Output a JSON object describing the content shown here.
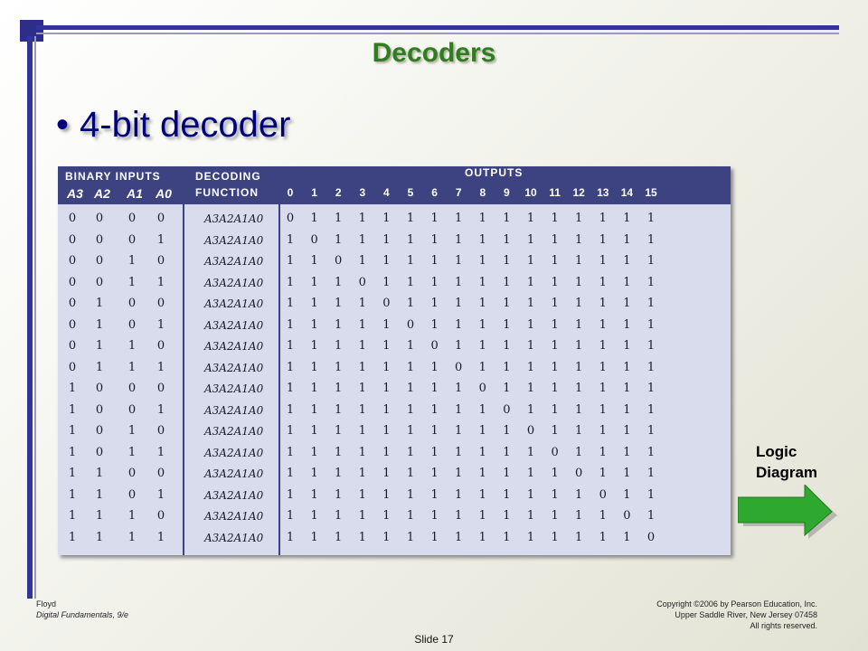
{
  "title": "Decoders",
  "bullet": "4-bit decoder",
  "table": {
    "group_headers": {
      "inputs": "BINARY INPUTS",
      "decoding": "DECODING",
      "function": "FUNCTION",
      "outputs": "OUTPUTS"
    },
    "input_headers": [
      "A3",
      "A2",
      "A1",
      "A0"
    ],
    "output_headers": [
      "0",
      "1",
      "2",
      "3",
      "4",
      "5",
      "6",
      "7",
      "8",
      "9",
      "10",
      "11",
      "12",
      "13",
      "14",
      "15"
    ],
    "rows": [
      {
        "inputs": [
          "0",
          "0",
          "0",
          "0"
        ],
        "fn": "A3A2A1A0",
        "outputs": [
          "0",
          "1",
          "1",
          "1",
          "1",
          "1",
          "1",
          "1",
          "1",
          "1",
          "1",
          "1",
          "1",
          "1",
          "1",
          "1"
        ]
      },
      {
        "inputs": [
          "0",
          "0",
          "0",
          "1"
        ],
        "fn": "A3A2A1A0",
        "outputs": [
          "1",
          "0",
          "1",
          "1",
          "1",
          "1",
          "1",
          "1",
          "1",
          "1",
          "1",
          "1",
          "1",
          "1",
          "1",
          "1"
        ]
      },
      {
        "inputs": [
          "0",
          "0",
          "1",
          "0"
        ],
        "fn": "A3A2A1A0",
        "outputs": [
          "1",
          "1",
          "0",
          "1",
          "1",
          "1",
          "1",
          "1",
          "1",
          "1",
          "1",
          "1",
          "1",
          "1",
          "1",
          "1"
        ]
      },
      {
        "inputs": [
          "0",
          "0",
          "1",
          "1"
        ],
        "fn": "A3A2A1A0",
        "outputs": [
          "1",
          "1",
          "1",
          "0",
          "1",
          "1",
          "1",
          "1",
          "1",
          "1",
          "1",
          "1",
          "1",
          "1",
          "1",
          "1"
        ]
      },
      {
        "inputs": [
          "0",
          "1",
          "0",
          "0"
        ],
        "fn": "A3A2A1A0",
        "outputs": [
          "1",
          "1",
          "1",
          "1",
          "0",
          "1",
          "1",
          "1",
          "1",
          "1",
          "1",
          "1",
          "1",
          "1",
          "1",
          "1"
        ]
      },
      {
        "inputs": [
          "0",
          "1",
          "0",
          "1"
        ],
        "fn": "A3A2A1A0",
        "outputs": [
          "1",
          "1",
          "1",
          "1",
          "1",
          "0",
          "1",
          "1",
          "1",
          "1",
          "1",
          "1",
          "1",
          "1",
          "1",
          "1"
        ]
      },
      {
        "inputs": [
          "0",
          "1",
          "1",
          "0"
        ],
        "fn": "A3A2A1A0",
        "outputs": [
          "1",
          "1",
          "1",
          "1",
          "1",
          "1",
          "0",
          "1",
          "1",
          "1",
          "1",
          "1",
          "1",
          "1",
          "1",
          "1"
        ]
      },
      {
        "inputs": [
          "0",
          "1",
          "1",
          "1"
        ],
        "fn": "A3A2A1A0",
        "outputs": [
          "1",
          "1",
          "1",
          "1",
          "1",
          "1",
          "1",
          "0",
          "1",
          "1",
          "1",
          "1",
          "1",
          "1",
          "1",
          "1"
        ]
      },
      {
        "inputs": [
          "1",
          "0",
          "0",
          "0"
        ],
        "fn": "A3A2A1A0",
        "outputs": [
          "1",
          "1",
          "1",
          "1",
          "1",
          "1",
          "1",
          "1",
          "0",
          "1",
          "1",
          "1",
          "1",
          "1",
          "1",
          "1"
        ]
      },
      {
        "inputs": [
          "1",
          "0",
          "0",
          "1"
        ],
        "fn": "A3A2A1A0",
        "outputs": [
          "1",
          "1",
          "1",
          "1",
          "1",
          "1",
          "1",
          "1",
          "1",
          "0",
          "1",
          "1",
          "1",
          "1",
          "1",
          "1"
        ]
      },
      {
        "inputs": [
          "1",
          "0",
          "1",
          "0"
        ],
        "fn": "A3A2A1A0",
        "outputs": [
          "1",
          "1",
          "1",
          "1",
          "1",
          "1",
          "1",
          "1",
          "1",
          "1",
          "0",
          "1",
          "1",
          "1",
          "1",
          "1"
        ]
      },
      {
        "inputs": [
          "1",
          "0",
          "1",
          "1"
        ],
        "fn": "A3A2A1A0",
        "outputs": [
          "1",
          "1",
          "1",
          "1",
          "1",
          "1",
          "1",
          "1",
          "1",
          "1",
          "1",
          "0",
          "1",
          "1",
          "1",
          "1"
        ]
      },
      {
        "inputs": [
          "1",
          "1",
          "0",
          "0"
        ],
        "fn": "A3A2A1A0",
        "outputs": [
          "1",
          "1",
          "1",
          "1",
          "1",
          "1",
          "1",
          "1",
          "1",
          "1",
          "1",
          "1",
          "0",
          "1",
          "1",
          "1"
        ]
      },
      {
        "inputs": [
          "1",
          "1",
          "0",
          "1"
        ],
        "fn": "A3A2A1A0",
        "outputs": [
          "1",
          "1",
          "1",
          "1",
          "1",
          "1",
          "1",
          "1",
          "1",
          "1",
          "1",
          "1",
          "1",
          "0",
          "1",
          "1"
        ]
      },
      {
        "inputs": [
          "1",
          "1",
          "1",
          "0"
        ],
        "fn": "A3A2A1A0",
        "outputs": [
          "1",
          "1",
          "1",
          "1",
          "1",
          "1",
          "1",
          "1",
          "1",
          "1",
          "1",
          "1",
          "1",
          "1",
          "0",
          "1"
        ]
      },
      {
        "inputs": [
          "1",
          "1",
          "1",
          "1"
        ],
        "fn": "A3A2A1A0",
        "outputs": [
          "1",
          "1",
          "1",
          "1",
          "1",
          "1",
          "1",
          "1",
          "1",
          "1",
          "1",
          "1",
          "1",
          "1",
          "1",
          "0"
        ]
      }
    ]
  },
  "logic_label_line1": "Logic",
  "logic_label_line2": "Diagram",
  "footer_left_line1": "Floyd",
  "footer_left_line2": "Digital Fundamentals, 9/e",
  "footer_right_line1": "Copyright ©2006 by Pearson Education, Inc.",
  "footer_right_line2": "Upper Saddle River, New Jersey 07458",
  "footer_right_line3": "All rights reserved.",
  "slide_number": "Slide 17",
  "colors": {
    "title": "#2e7d1e",
    "bullet": "#00007a",
    "frame": "#33339a",
    "arrow": "#2fa82f"
  },
  "icons": {
    "arrow": "right-arrow-icon"
  }
}
